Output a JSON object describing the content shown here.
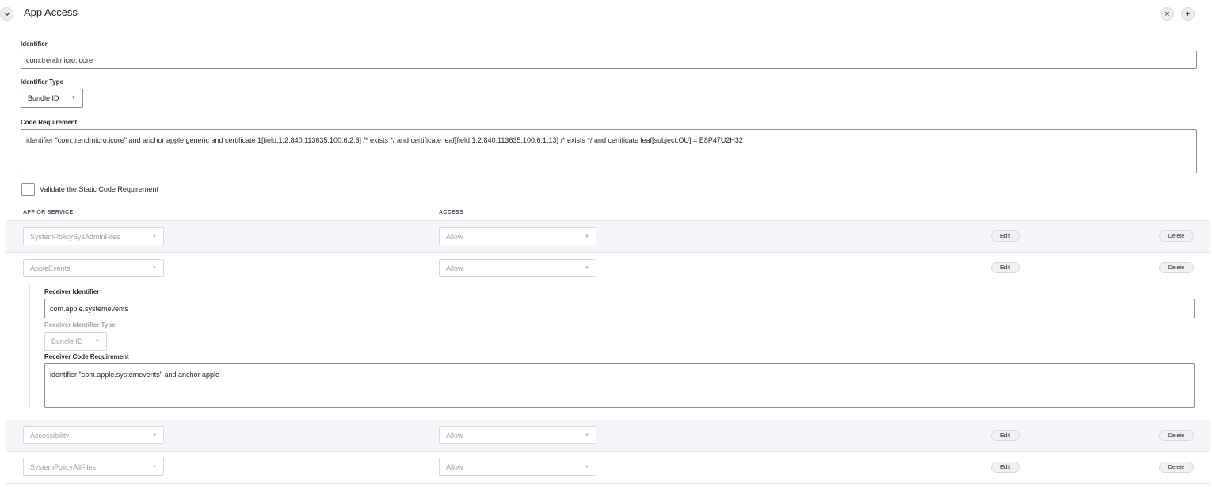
{
  "header": {
    "title": "App Access",
    "close_label": "×",
    "add_label": "+"
  },
  "identifier": {
    "label": "Identifier",
    "value": "com.trendmicro.icore"
  },
  "identifier_type": {
    "label": "Identifier Type",
    "value": "Bundle ID"
  },
  "code_requirement": {
    "label": "Code Requirement",
    "value": "identifier \"com.trendmicro.icore\" and anchor apple generic and certificate 1[field.1.2.840.113635.100.6.2.6] /* exists */ and certificate leaf[field.1.2.840.113635.100.6.1.13] /* exists */ and certificate leaf[subject.OU] = E8P47U2H32"
  },
  "validate": {
    "label": "Validate the Static Code Requirement",
    "checked": false
  },
  "table": {
    "col_app": "APP OR SERVICE",
    "col_access": "ACCESS",
    "edit_label": "Edit",
    "delete_label": "Delete",
    "rows": [
      {
        "service": "SystemPolicySysAdminFiles",
        "access": "Allow"
      },
      {
        "service": "AppleEvents",
        "access": "Allow"
      },
      {
        "service": "Accessibility",
        "access": "Allow"
      },
      {
        "service": "SystemPolicyAllFiles",
        "access": "Allow"
      }
    ]
  },
  "receiver": {
    "identifier_label": "Receiver Identifier",
    "identifier_value": "com.apple.systemevents",
    "type_label": "Receiver Identifier Type",
    "type_value": "Bundle ID",
    "code_label": "Receiver Code Requirement",
    "code_value": "identifier \"com.apple.systemevents\" and anchor apple"
  }
}
